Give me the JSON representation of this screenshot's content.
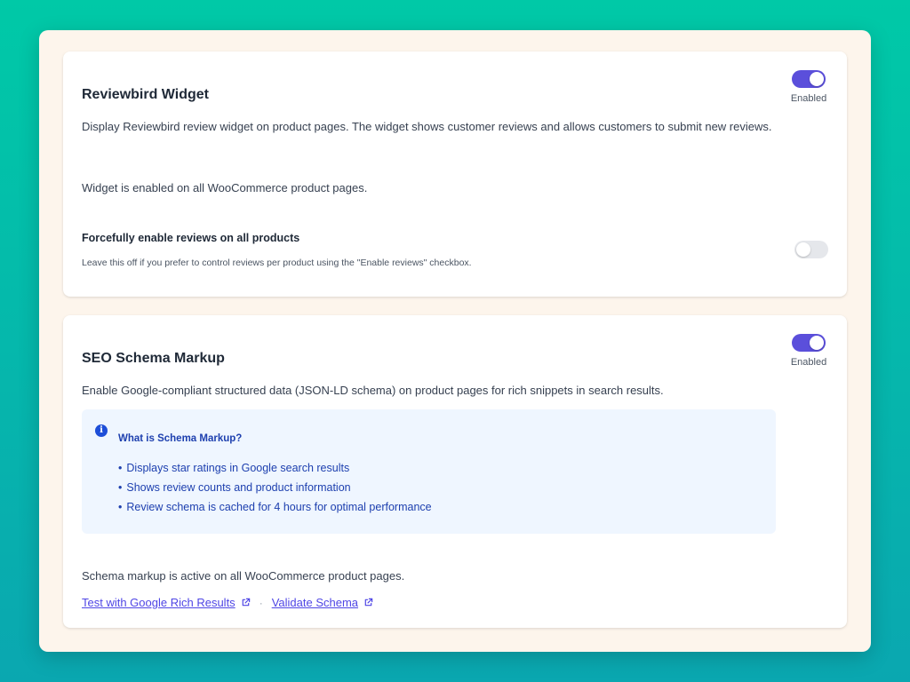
{
  "widget_card": {
    "title": "Reviewbird Widget",
    "description": "Display Reviewbird review widget on product pages. The widget shows customer reviews and allows customers to submit new reviews.",
    "toggle": {
      "state": "on",
      "label": "Enabled"
    },
    "status": "Widget is enabled on all WooCommerce product pages.",
    "force": {
      "title": "Forcefully enable reviews on all products",
      "hint": "Leave this off if you prefer to control reviews per product using the \"Enable reviews\" checkbox.",
      "state": "off"
    }
  },
  "seo_card": {
    "title": "SEO Schema Markup",
    "description": "Enable Google-compliant structured data (JSON-LD schema) on product pages for rich snippets in search results.",
    "toggle": {
      "state": "on",
      "label": "Enabled"
    },
    "info": {
      "icon": "info-icon",
      "title": "What is Schema Markup?",
      "items": [
        "Displays star ratings in Google search results",
        "Shows review counts and product information",
        "Review schema is cached for 4 hours for optimal performance"
      ]
    },
    "status": "Schema markup is active on all WooCommerce product pages.",
    "links": {
      "test": "Test with Google Rich Results",
      "separator": "·",
      "validate": "Validate Schema"
    }
  },
  "colors": {
    "accent": "#5b4fdb",
    "link": "#4f46e5",
    "info_bg": "#eff6ff",
    "info_text": "#1e40af"
  }
}
